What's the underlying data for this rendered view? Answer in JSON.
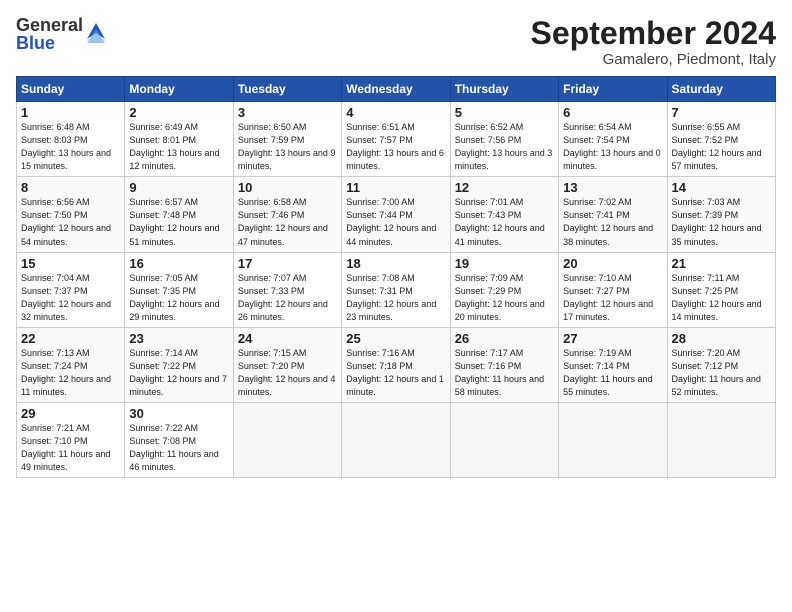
{
  "header": {
    "logo_line1": "General",
    "logo_line2": "Blue",
    "month_title": "September 2024",
    "location": "Gamalero, Piedmont, Italy"
  },
  "calendar": {
    "days_of_week": [
      "Sunday",
      "Monday",
      "Tuesday",
      "Wednesday",
      "Thursday",
      "Friday",
      "Saturday"
    ],
    "weeks": [
      [
        {
          "day": "1",
          "sunrise": "Sunrise: 6:48 AM",
          "sunset": "Sunset: 8:03 PM",
          "daylight": "Daylight: 13 hours and 15 minutes."
        },
        {
          "day": "2",
          "sunrise": "Sunrise: 6:49 AM",
          "sunset": "Sunset: 8:01 PM",
          "daylight": "Daylight: 13 hours and 12 minutes."
        },
        {
          "day": "3",
          "sunrise": "Sunrise: 6:50 AM",
          "sunset": "Sunset: 7:59 PM",
          "daylight": "Daylight: 13 hours and 9 minutes."
        },
        {
          "day": "4",
          "sunrise": "Sunrise: 6:51 AM",
          "sunset": "Sunset: 7:57 PM",
          "daylight": "Daylight: 13 hours and 6 minutes."
        },
        {
          "day": "5",
          "sunrise": "Sunrise: 6:52 AM",
          "sunset": "Sunset: 7:56 PM",
          "daylight": "Daylight: 13 hours and 3 minutes."
        },
        {
          "day": "6",
          "sunrise": "Sunrise: 6:54 AM",
          "sunset": "Sunset: 7:54 PM",
          "daylight": "Daylight: 13 hours and 0 minutes."
        },
        {
          "day": "7",
          "sunrise": "Sunrise: 6:55 AM",
          "sunset": "Sunset: 7:52 PM",
          "daylight": "Daylight: 12 hours and 57 minutes."
        }
      ],
      [
        {
          "day": "8",
          "sunrise": "Sunrise: 6:56 AM",
          "sunset": "Sunset: 7:50 PM",
          "daylight": "Daylight: 12 hours and 54 minutes."
        },
        {
          "day": "9",
          "sunrise": "Sunrise: 6:57 AM",
          "sunset": "Sunset: 7:48 PM",
          "daylight": "Daylight: 12 hours and 51 minutes."
        },
        {
          "day": "10",
          "sunrise": "Sunrise: 6:58 AM",
          "sunset": "Sunset: 7:46 PM",
          "daylight": "Daylight: 12 hours and 47 minutes."
        },
        {
          "day": "11",
          "sunrise": "Sunrise: 7:00 AM",
          "sunset": "Sunset: 7:44 PM",
          "daylight": "Daylight: 12 hours and 44 minutes."
        },
        {
          "day": "12",
          "sunrise": "Sunrise: 7:01 AM",
          "sunset": "Sunset: 7:43 PM",
          "daylight": "Daylight: 12 hours and 41 minutes."
        },
        {
          "day": "13",
          "sunrise": "Sunrise: 7:02 AM",
          "sunset": "Sunset: 7:41 PM",
          "daylight": "Daylight: 12 hours and 38 minutes."
        },
        {
          "day": "14",
          "sunrise": "Sunrise: 7:03 AM",
          "sunset": "Sunset: 7:39 PM",
          "daylight": "Daylight: 12 hours and 35 minutes."
        }
      ],
      [
        {
          "day": "15",
          "sunrise": "Sunrise: 7:04 AM",
          "sunset": "Sunset: 7:37 PM",
          "daylight": "Daylight: 12 hours and 32 minutes."
        },
        {
          "day": "16",
          "sunrise": "Sunrise: 7:05 AM",
          "sunset": "Sunset: 7:35 PM",
          "daylight": "Daylight: 12 hours and 29 minutes."
        },
        {
          "day": "17",
          "sunrise": "Sunrise: 7:07 AM",
          "sunset": "Sunset: 7:33 PM",
          "daylight": "Daylight: 12 hours and 26 minutes."
        },
        {
          "day": "18",
          "sunrise": "Sunrise: 7:08 AM",
          "sunset": "Sunset: 7:31 PM",
          "daylight": "Daylight: 12 hours and 23 minutes."
        },
        {
          "day": "19",
          "sunrise": "Sunrise: 7:09 AM",
          "sunset": "Sunset: 7:29 PM",
          "daylight": "Daylight: 12 hours and 20 minutes."
        },
        {
          "day": "20",
          "sunrise": "Sunrise: 7:10 AM",
          "sunset": "Sunset: 7:27 PM",
          "daylight": "Daylight: 12 hours and 17 minutes."
        },
        {
          "day": "21",
          "sunrise": "Sunrise: 7:11 AM",
          "sunset": "Sunset: 7:25 PM",
          "daylight": "Daylight: 12 hours and 14 minutes."
        }
      ],
      [
        {
          "day": "22",
          "sunrise": "Sunrise: 7:13 AM",
          "sunset": "Sunset: 7:24 PM",
          "daylight": "Daylight: 12 hours and 11 minutes."
        },
        {
          "day": "23",
          "sunrise": "Sunrise: 7:14 AM",
          "sunset": "Sunset: 7:22 PM",
          "daylight": "Daylight: 12 hours and 7 minutes."
        },
        {
          "day": "24",
          "sunrise": "Sunrise: 7:15 AM",
          "sunset": "Sunset: 7:20 PM",
          "daylight": "Daylight: 12 hours and 4 minutes."
        },
        {
          "day": "25",
          "sunrise": "Sunrise: 7:16 AM",
          "sunset": "Sunset: 7:18 PM",
          "daylight": "Daylight: 12 hours and 1 minute."
        },
        {
          "day": "26",
          "sunrise": "Sunrise: 7:17 AM",
          "sunset": "Sunset: 7:16 PM",
          "daylight": "Daylight: 11 hours and 58 minutes."
        },
        {
          "day": "27",
          "sunrise": "Sunrise: 7:19 AM",
          "sunset": "Sunset: 7:14 PM",
          "daylight": "Daylight: 11 hours and 55 minutes."
        },
        {
          "day": "28",
          "sunrise": "Sunrise: 7:20 AM",
          "sunset": "Sunset: 7:12 PM",
          "daylight": "Daylight: 11 hours and 52 minutes."
        }
      ],
      [
        {
          "day": "29",
          "sunrise": "Sunrise: 7:21 AM",
          "sunset": "Sunset: 7:10 PM",
          "daylight": "Daylight: 11 hours and 49 minutes."
        },
        {
          "day": "30",
          "sunrise": "Sunrise: 7:22 AM",
          "sunset": "Sunset: 7:08 PM",
          "daylight": "Daylight: 11 hours and 46 minutes."
        },
        null,
        null,
        null,
        null,
        null
      ]
    ]
  }
}
